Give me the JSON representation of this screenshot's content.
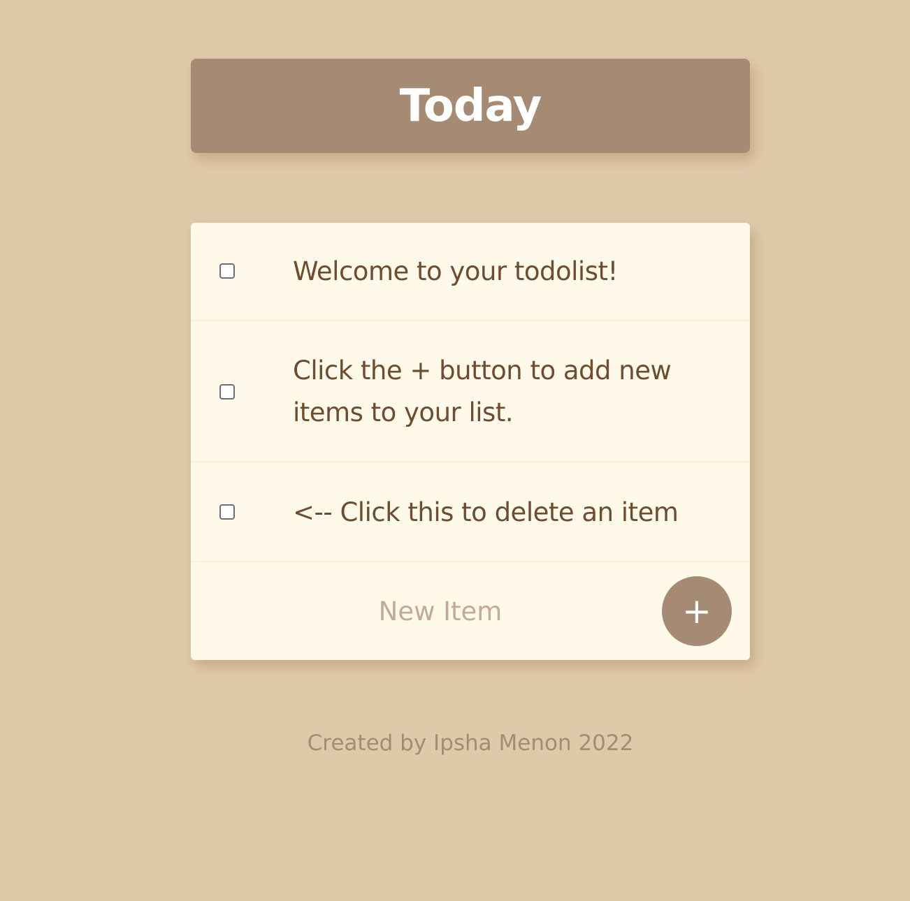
{
  "heading": {
    "title": "Today"
  },
  "todo_items": [
    {
      "text": "Welcome to your todolist!",
      "checked": false
    },
    {
      "text": "Click the + button to add new items to your list.",
      "checked": false
    },
    {
      "text": "<-- Click this to delete an item",
      "checked": false
    }
  ],
  "new_item": {
    "placeholder": "New Item",
    "value": "",
    "add_button_label": "+"
  },
  "footer": {
    "text": "Created by Ipsha Menon 2022"
  },
  "colors": {
    "background": "#E0C9A9",
    "heading_bg": "#A68B74",
    "card_bg": "#FEF9E8",
    "item_text": "#6D4C30",
    "placeholder": "#C4A993",
    "footer_text": "#A68B74"
  }
}
